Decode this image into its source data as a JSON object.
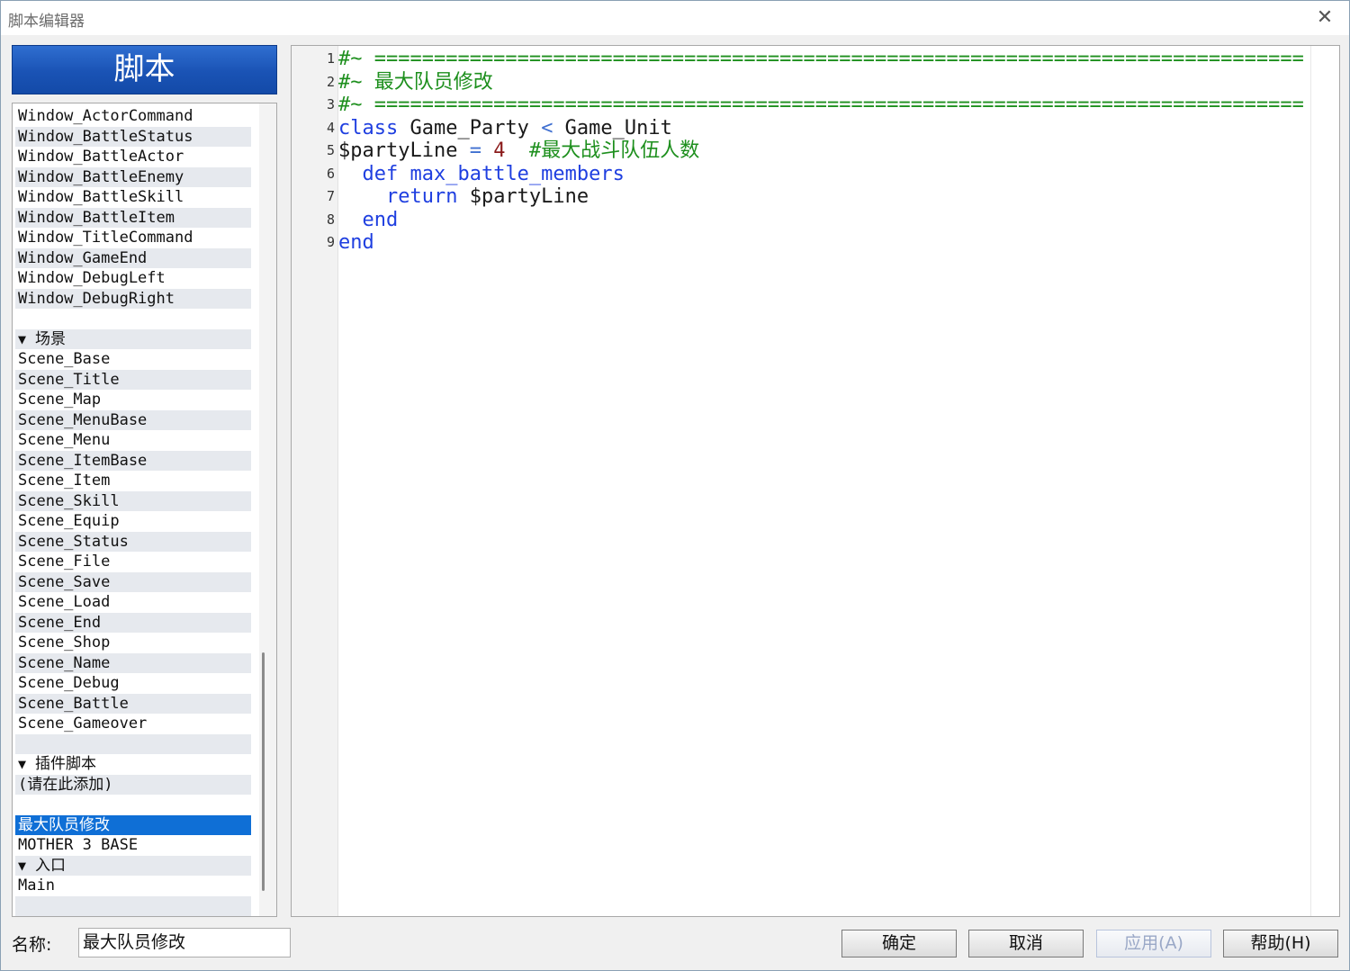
{
  "window": {
    "title": "脚本编辑器",
    "close_glyph": "✕"
  },
  "sidebar": {
    "header": "脚本",
    "items": [
      {
        "label": "Window_ActorCommand"
      },
      {
        "label": "Window_BattleStatus"
      },
      {
        "label": "Window_BattleActor"
      },
      {
        "label": "Window_BattleEnemy"
      },
      {
        "label": "Window_BattleSkill"
      },
      {
        "label": "Window_BattleItem"
      },
      {
        "label": "Window_TitleCommand"
      },
      {
        "label": "Window_GameEnd"
      },
      {
        "label": "Window_DebugLeft"
      },
      {
        "label": "Window_DebugRight"
      },
      {
        "label": ""
      },
      {
        "label": "场景",
        "section": true
      },
      {
        "label": "Scene_Base"
      },
      {
        "label": "Scene_Title"
      },
      {
        "label": "Scene_Map"
      },
      {
        "label": "Scene_MenuBase"
      },
      {
        "label": "Scene_Menu"
      },
      {
        "label": "Scene_ItemBase"
      },
      {
        "label": "Scene_Item"
      },
      {
        "label": "Scene_Skill"
      },
      {
        "label": "Scene_Equip"
      },
      {
        "label": "Scene_Status"
      },
      {
        "label": "Scene_File"
      },
      {
        "label": "Scene_Save"
      },
      {
        "label": "Scene_Load"
      },
      {
        "label": "Scene_End"
      },
      {
        "label": "Scene_Shop"
      },
      {
        "label": "Scene_Name"
      },
      {
        "label": "Scene_Debug"
      },
      {
        "label": "Scene_Battle"
      },
      {
        "label": "Scene_Gameover"
      },
      {
        "label": ""
      },
      {
        "label": "插件脚本",
        "section": true
      },
      {
        "label": "(请在此添加)"
      },
      {
        "label": ""
      },
      {
        "label": "最大队员修改",
        "selected": true
      },
      {
        "label": "MOTHER 3 BASE"
      },
      {
        "label": "入口",
        "section": true
      },
      {
        "label": "Main"
      },
      {
        "label": ""
      }
    ],
    "section_glyph": "▼"
  },
  "editor": {
    "lines": [
      {
        "n": "1",
        "tokens": [
          {
            "t": "#~ ==============================================================================",
            "c": "comment"
          }
        ]
      },
      {
        "n": "2",
        "tokens": [
          {
            "t": "#~ 最大队员修改",
            "c": "comment"
          }
        ]
      },
      {
        "n": "3",
        "tokens": [
          {
            "t": "#~ ==============================================================================",
            "c": "comment"
          }
        ]
      },
      {
        "n": "4",
        "tokens": [
          {
            "t": "class",
            "c": "kw"
          },
          {
            "t": " Game_Party ",
            "c": "plain"
          },
          {
            "t": "<",
            "c": "op"
          },
          {
            "t": " Game_Unit",
            "c": "plain"
          }
        ]
      },
      {
        "n": "5",
        "tokens": [
          {
            "t": "$partyLine ",
            "c": "plain"
          },
          {
            "t": "=",
            "c": "op"
          },
          {
            "t": " ",
            "c": "plain"
          },
          {
            "t": "4",
            "c": "num"
          },
          {
            "t": "  #最大战斗队伍人数",
            "c": "comment"
          }
        ]
      },
      {
        "n": "6",
        "tokens": [
          {
            "t": "  def",
            "c": "kw"
          },
          {
            "t": " max_battle_members",
            "c": "kw"
          }
        ]
      },
      {
        "n": "7",
        "tokens": [
          {
            "t": "    return",
            "c": "kw"
          },
          {
            "t": " $partyLine",
            "c": "plain"
          }
        ]
      },
      {
        "n": "8",
        "tokens": [
          {
            "t": "  end",
            "c": "kw"
          }
        ]
      },
      {
        "n": "9",
        "tokens": [
          {
            "t": "end",
            "c": "kw"
          }
        ]
      }
    ]
  },
  "footer": {
    "name_label": "名称:",
    "name_value": "最大队员修改",
    "ok_label": "确定",
    "cancel_label": "取消",
    "apply_label": "应用(A)",
    "help_label": "帮助(H)"
  }
}
